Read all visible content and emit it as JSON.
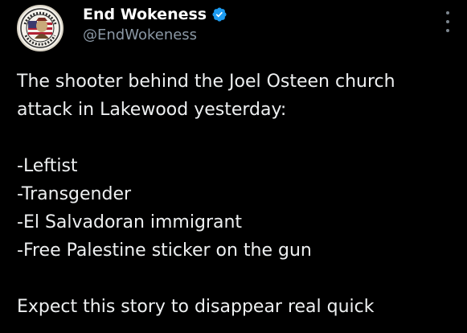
{
  "author": {
    "display_name": "End Wokeness",
    "handle": "@EndWokeness",
    "verified": true,
    "avatar_icon": "patriot-emblem-avatar",
    "verified_color": "#1d9bf0"
  },
  "menu": {
    "icon": "more-vertical-icon"
  },
  "tweet": {
    "lines": [
      "The shooter behind the Joel Osteen church",
      "attack in Lakewood yesterday:",
      "",
      "-Leftist",
      "-Transgender",
      "-El Salvadoran immigrant",
      "-Free Palestine sticker on the gun",
      "",
      "Expect this story to disappear real quick"
    ]
  },
  "colors": {
    "background": "#000000",
    "text": "#e7e9ea",
    "secondary_text": "#8b98a5"
  }
}
